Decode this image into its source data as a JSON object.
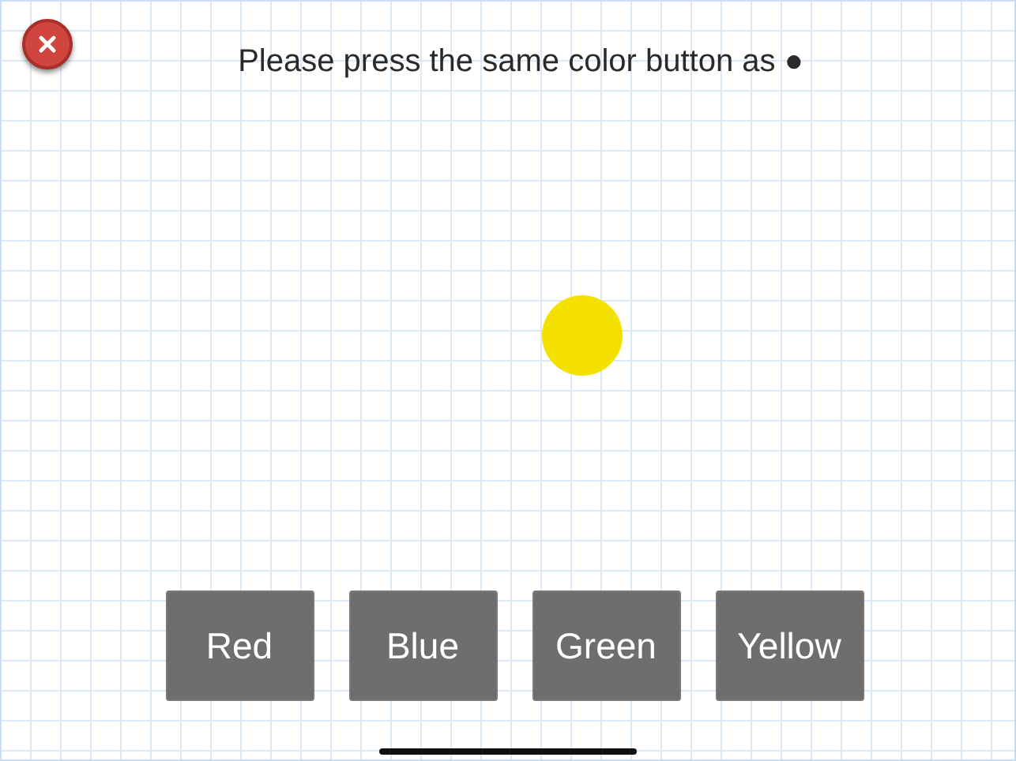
{
  "prompt": "Please press the same color button as ●",
  "target": {
    "color": "#f5e100"
  },
  "buttons": [
    {
      "label": "Red"
    },
    {
      "label": "Blue"
    },
    {
      "label": "Green"
    },
    {
      "label": "Yellow"
    }
  ]
}
